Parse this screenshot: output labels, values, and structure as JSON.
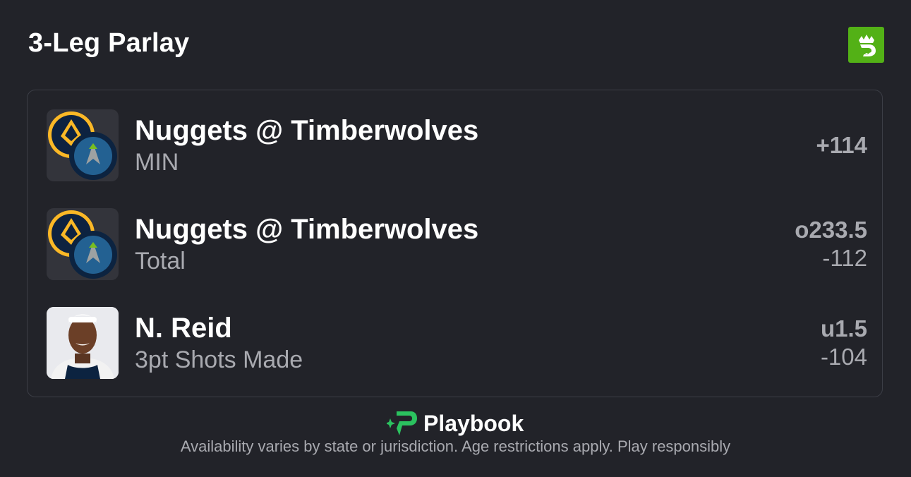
{
  "header": {
    "title": "3-Leg Parlay",
    "brand_icon": "draftkings-crown-logo",
    "brand_color": "#53b116"
  },
  "legs": [
    {
      "image": "nuggets-timberwolves-team-logos",
      "title": "Nuggets @ Timberwolves",
      "subtitle": "MIN",
      "line": "+114",
      "odds": ""
    },
    {
      "image": "nuggets-timberwolves-team-logos",
      "title": "Nuggets @ Timberwolves",
      "subtitle": "Total",
      "line": "o233.5",
      "odds": "-112"
    },
    {
      "image": "player-headshot",
      "title": "N. Reid",
      "subtitle": "3pt Shots Made",
      "line": "u1.5",
      "odds": "-104"
    }
  ],
  "footer": {
    "brand_name": "Playbook",
    "brand_icon": "playbook-logo",
    "brand_color": "#2bc25f",
    "disclaimer": "Availability varies by state or jurisdiction. Age restrictions apply. Play responsibly"
  }
}
